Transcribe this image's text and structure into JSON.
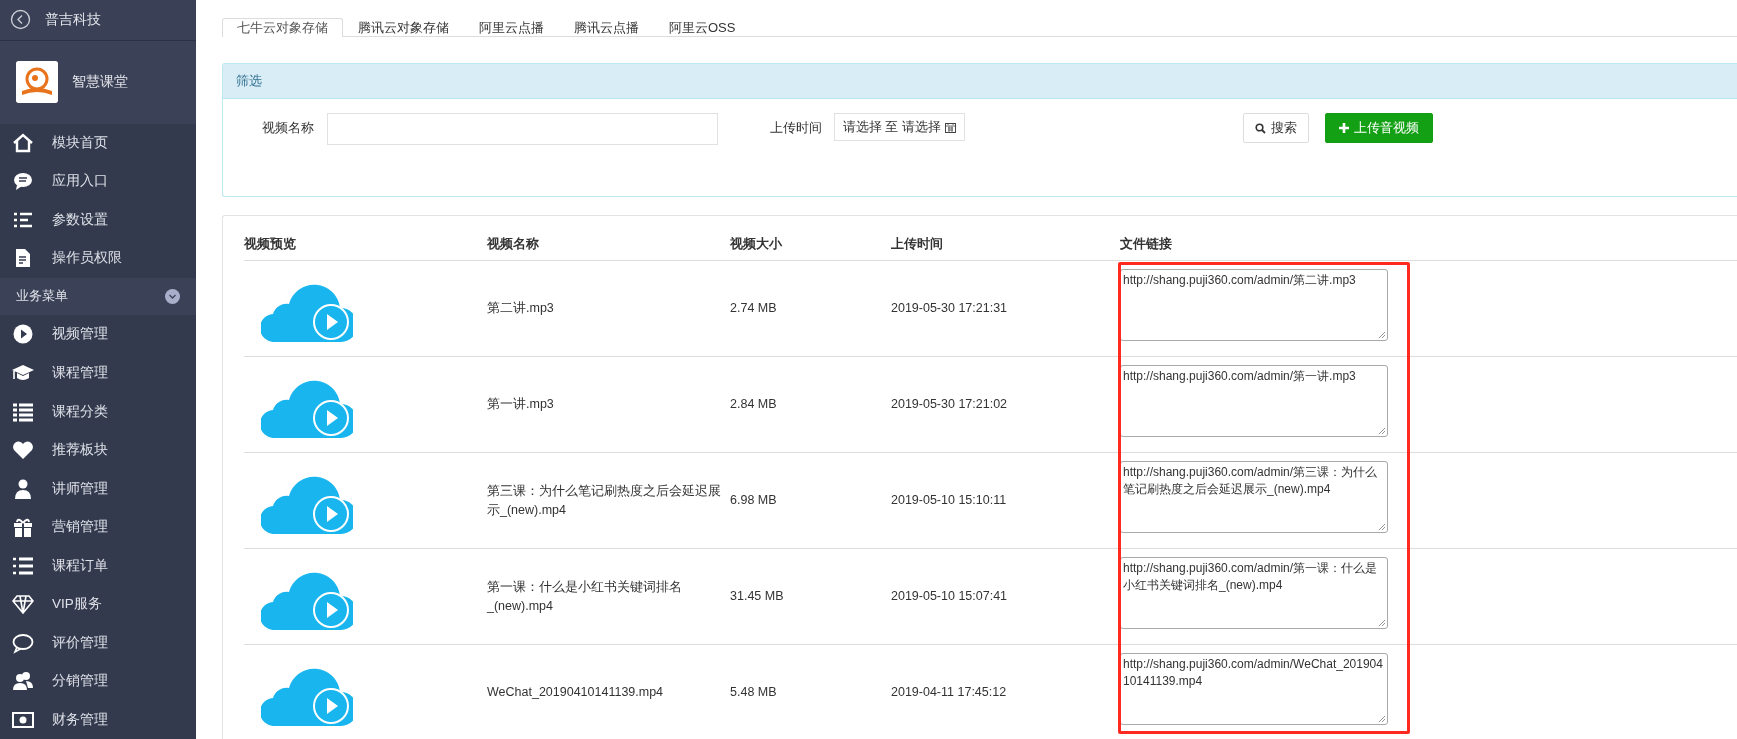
{
  "sidebar": {
    "header": {
      "title": "普吉科技"
    },
    "brand": {
      "name": "智慧课堂"
    },
    "items": [
      {
        "label": "模块首页"
      },
      {
        "label": "应用入口"
      },
      {
        "label": "参数设置"
      },
      {
        "label": "操作员权限"
      }
    ],
    "group": {
      "label": "业务菜单",
      "expanded": true,
      "items": [
        {
          "label": "视频管理"
        },
        {
          "label": "课程管理"
        },
        {
          "label": "课程分类"
        },
        {
          "label": "推荐板块"
        },
        {
          "label": "讲师管理"
        },
        {
          "label": "营销管理"
        },
        {
          "label": "课程订单"
        },
        {
          "label": "VIP服务"
        },
        {
          "label": "评价管理"
        },
        {
          "label": "分销管理"
        },
        {
          "label": "财务管理"
        }
      ]
    }
  },
  "tabs": [
    {
      "label": "七牛云对象存储",
      "selected": true
    },
    {
      "label": "腾讯云对象存储",
      "selected": false
    },
    {
      "label": "阿里云点播",
      "selected": false
    },
    {
      "label": "腾讯云点播",
      "selected": false
    },
    {
      "label": "阿里云OSS",
      "selected": false
    }
  ],
  "filter": {
    "title": "筛选",
    "name_label": "视频名称",
    "time_label": "上传时间",
    "date_range": "请选择 至 请选择",
    "search_button": "搜索",
    "upload_button": "上传音视频"
  },
  "table": {
    "columns": [
      "视频预览",
      "视频名称",
      "视频大小",
      "上传时间",
      "文件链接"
    ],
    "rows": [
      {
        "name": "第二讲.mp3",
        "size": "2.74 MB",
        "time": "2019-05-30 17:21:31",
        "link": "http://shang.puji360.com/admin/第二讲.mp3"
      },
      {
        "name": "第一讲.mp3",
        "size": "2.84 MB",
        "time": "2019-05-30 17:21:02",
        "link": "http://shang.puji360.com/admin/第一讲.mp3"
      },
      {
        "name": "第三课：为什么笔记刷热度之后会延迟展示_(new).mp4",
        "size": "6.98 MB",
        "time": "2019-05-10 15:10:11",
        "link": "http://shang.puji360.com/admin/第三课：为什么笔记刷热度之后会延迟展示_(new).mp4"
      },
      {
        "name": "第一课：什么是小红书关键词排名_(new).mp4",
        "size": "31.45 MB",
        "time": "2019-05-10 15:07:41",
        "link": "http://shang.puji360.com/admin/第一课：什么是小红书关键词排名_(new).mp4"
      },
      {
        "name": "WeChat_20190410141139.mp4",
        "size": "5.48 MB",
        "time": "2019-04-11 17:45:12",
        "link": "http://shang.puji360.com/admin/WeChat_20190410141139.mp4"
      }
    ]
  },
  "annotation": {
    "kind": "highlight"
  }
}
